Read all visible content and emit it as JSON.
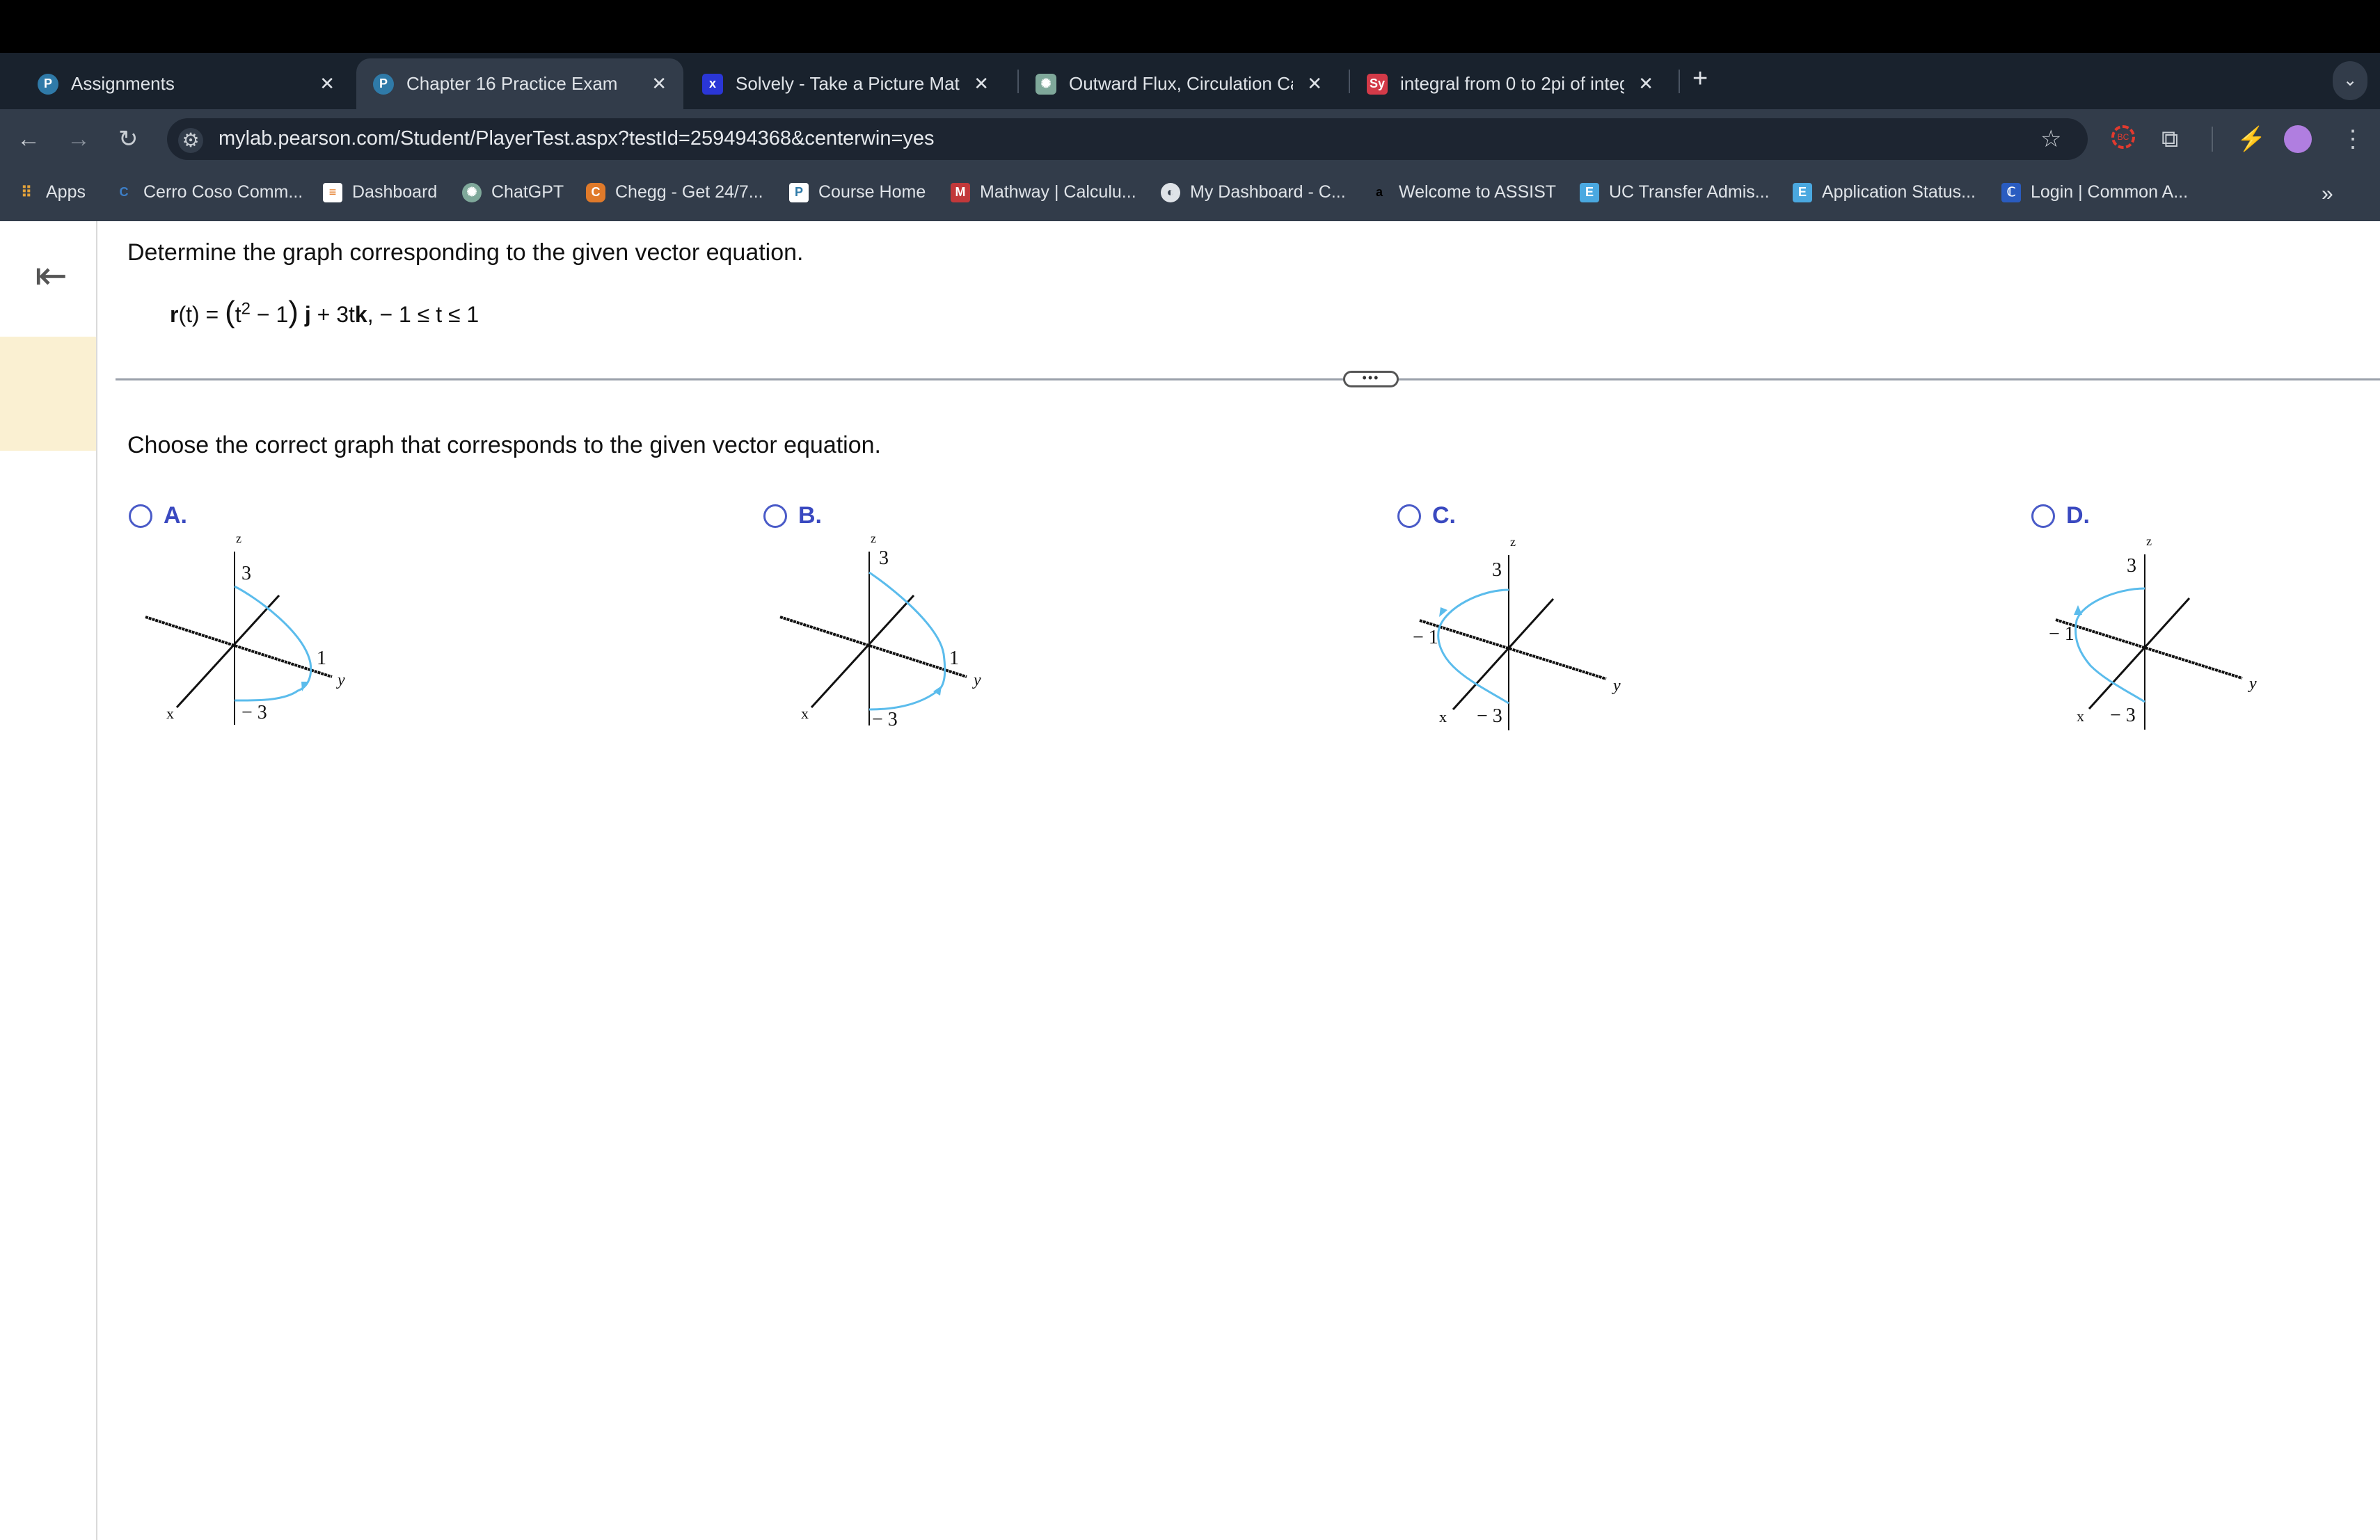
{
  "browser": {
    "tabs": [
      {
        "title": "Assignments",
        "icon": "pearson-icon",
        "color": "#2f7aa8",
        "active": false
      },
      {
        "title": "Chapter 16 Practice Exam",
        "icon": "pearson-icon",
        "color": "#2f7aa8",
        "active": true
      },
      {
        "title": "Solvely - Take a Picture Math",
        "icon": "solvely-icon",
        "color": "#2a36d6",
        "active": false
      },
      {
        "title": "Outward Flux, Circulation Calc",
        "icon": "chatgpt-icon",
        "color": "#7fa89a",
        "active": false
      },
      {
        "title": "integral from 0 to 2pi of integ",
        "icon": "symbolab-icon",
        "color": "#d33a48",
        "active": false
      }
    ],
    "new_tab": "+",
    "url": "mylab.pearson.com/Student/PlayerTest.aspx?testId=259494368&centerwin=yes",
    "bookmarks": [
      {
        "label": "Apps",
        "icon": "apps-grid-icon"
      },
      {
        "label": "Cerro Coso Comm...",
        "icon": "cerro-coso-icon"
      },
      {
        "label": "Dashboard",
        "icon": "dashboard-icon"
      },
      {
        "label": "ChatGPT",
        "icon": "chatgpt-icon"
      },
      {
        "label": "Chegg - Get 24/7...",
        "icon": "chegg-icon"
      },
      {
        "label": "Course Home",
        "icon": "pearson-icon"
      },
      {
        "label": "Mathway | Calculu...",
        "icon": "mathway-icon"
      },
      {
        "label": "My Dashboard - C...",
        "icon": "globe-icon"
      },
      {
        "label": "Welcome to ASSIST",
        "icon": "assist-icon"
      },
      {
        "label": "UC Transfer Admis...",
        "icon": "uc-icon"
      },
      {
        "label": "Application Status...",
        "icon": "uc-icon"
      },
      {
        "label": "Login | Common A...",
        "icon": "common-app-icon"
      }
    ]
  },
  "question": {
    "prompt": "Determine the graph corresponding to the given vector equation.",
    "equation": {
      "lhs": "r",
      "lhs_rest": "(t) = ",
      "open": "(",
      "t": "t",
      "exp": "2",
      "minus1": " − 1",
      "close": ")",
      "j": "j",
      "plus": " + 3t",
      "k": "k",
      "range": ",  − 1 ≤ t ≤ 1"
    },
    "more": "•••",
    "instruction": "Choose the correct graph that corresponds to the given vector equation."
  },
  "options": [
    {
      "label": "A.",
      "z": "z",
      "x": "x",
      "y": "y",
      "top": "3",
      "bottom": "− 3",
      "side": "1"
    },
    {
      "label": "B.",
      "z": "z",
      "x": "x",
      "y": "y",
      "top": "3",
      "bottom": "− 3",
      "side": "1"
    },
    {
      "label": "C.",
      "z": "z",
      "x": "x",
      "y": "y",
      "top": "3",
      "bottom": "− 3",
      "side": "− 1"
    },
    {
      "label": "D.",
      "z": "z",
      "x": "x",
      "y": "y",
      "top": "3",
      "bottom": "− 3",
      "side": "− 1"
    }
  ],
  "colors": {
    "curve": "#5bbcec",
    "option_label": "#3a49c0",
    "sidebar_highlight": "#faf0d2"
  }
}
